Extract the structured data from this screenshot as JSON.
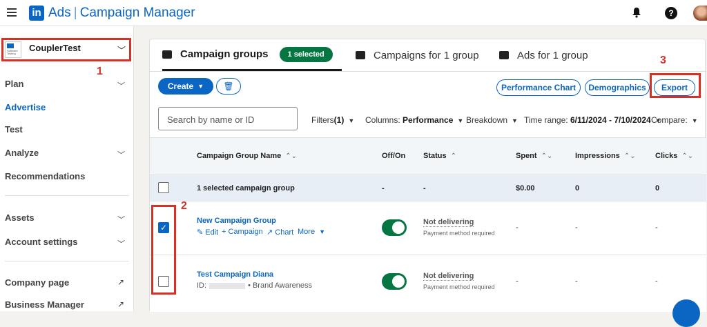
{
  "topbar": {
    "logo_letters": "in",
    "app_name": "Ads",
    "app_section": "Campaign Manager"
  },
  "sidebar": {
    "account_name": "CouplerTest",
    "account_logo_text": "Software Testing",
    "items": [
      {
        "label": "Plan"
      },
      {
        "label": "Advertise"
      },
      {
        "label": "Test"
      },
      {
        "label": "Analyze"
      },
      {
        "label": "Recommendations"
      },
      {
        "label": "Assets"
      },
      {
        "label": "Account settings"
      },
      {
        "label": "Company page"
      },
      {
        "label": "Business Manager"
      }
    ]
  },
  "tabs": [
    {
      "label": "Campaign groups",
      "badge": "1 selected"
    },
    {
      "label": "Campaigns for 1 group"
    },
    {
      "label": "Ads for 1 group"
    }
  ],
  "toolbar": {
    "create_label": "Create",
    "performance_chart": "Performance Chart",
    "demographics": "Demographics",
    "export": "Export"
  },
  "filters": {
    "search_placeholder": "Search by name or ID",
    "filters_label": "Filters",
    "filters_count": "(1)",
    "columns_label": "Columns:",
    "columns_value": "Performance",
    "breakdown": "Breakdown",
    "time_range_label": "Time range:",
    "time_range_value": "6/11/2024 - 7/10/2024",
    "compare": "Compare:"
  },
  "table": {
    "headers": [
      "Campaign Group Name",
      "Off/On",
      "Status",
      "Spent",
      "Impressions",
      "Clicks"
    ],
    "summary": {
      "label": "1 selected campaign group",
      "offon": "-",
      "status": "-",
      "spent": "$0.00",
      "impressions": "0",
      "clicks": "0"
    },
    "rows": [
      {
        "name": "New Campaign Group",
        "actions": [
          "✎ Edit",
          "+ Campaign",
          "↗ Chart",
          "More"
        ],
        "checked": true,
        "status": "Not delivering",
        "status_sub": "Payment method required",
        "spent": "-",
        "impressions": "-",
        "clicks": "-"
      },
      {
        "name": "Test Campaign Diana",
        "id_label": "ID:",
        "objective": "• Brand Awareness",
        "checked": false,
        "status": "Not delivering",
        "status_sub": "Payment method required",
        "spent": "-",
        "impressions": "-",
        "clicks": "-"
      }
    ]
  },
  "annotations": [
    "1",
    "2",
    "3"
  ],
  "colors": {
    "accent": "#0a66c2",
    "success": "#057642",
    "annotation": "#d93025"
  }
}
